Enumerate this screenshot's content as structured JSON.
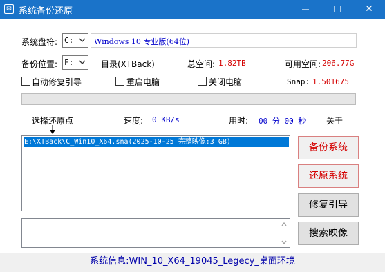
{
  "window": {
    "title": "系统备份还原",
    "app_icon_glyph": "✉",
    "minimize_glyph": "—",
    "maximize_glyph": "☐",
    "close_glyph": "✕"
  },
  "system_disk": {
    "label": "系统盘符:",
    "drive_value": "C:",
    "os_text": "Windows 10 专业版(64位)"
  },
  "backup": {
    "label": "备份位置:",
    "drive_value": "F:",
    "directory_text": "目录(XTBack)",
    "total_label": "总空间:",
    "total_value": "1.82TB",
    "free_label": "可用空间:",
    "free_value": "206.77G"
  },
  "options": {
    "auto_repair": "自动修复引导",
    "restart": "重启电脑",
    "shutdown": "关闭电脑",
    "snap_label": "Snap:",
    "snap_value": "1.501675"
  },
  "progress": {
    "fraction": 0
  },
  "info_row": {
    "select_restore_point": "选择还原点",
    "speed_label": "速度:",
    "speed_value": "0 KB/s",
    "time_label": "用时:",
    "time_value": "00 分 00 秒",
    "about": "关于"
  },
  "image_list": {
    "items": [
      "E:\\XTBack\\C_Win10_X64.sna(2025-10-25 完整映像:3 GB)"
    ]
  },
  "log_box": {
    "text": ""
  },
  "buttons": {
    "backup": "备份系统",
    "restore": "还原系统",
    "repair_boot": "修复引导",
    "search_images": "搜索映像"
  },
  "status": {
    "text": "系统信息:WIN_10_X64_19045_Legecy_桌面环境"
  },
  "colors": {
    "titlebar": "#1a73c9",
    "accent_red": "#d40000",
    "accent_blue": "#0000cc",
    "selection": "#0078d7"
  }
}
